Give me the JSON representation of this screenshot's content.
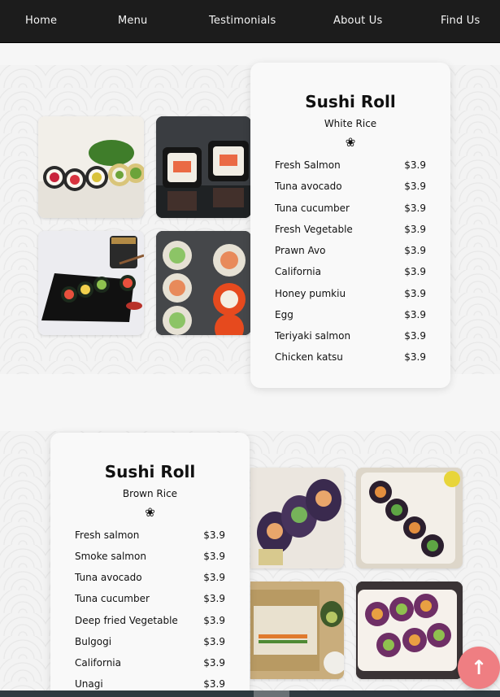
{
  "nav": {
    "items": [
      {
        "label": "Home"
      },
      {
        "label": "Menu"
      },
      {
        "label": "Testimonials"
      },
      {
        "label": "About Us"
      },
      {
        "label": "Find Us"
      }
    ]
  },
  "menu_white": {
    "title": "Sushi Roll",
    "subtitle": "White Rice",
    "ornament": "❀",
    "items": [
      {
        "name": "Fresh Salmon",
        "price": "$3.9"
      },
      {
        "name": "Tuna avocado",
        "price": "$3.9"
      },
      {
        "name": "Tuna cucumber",
        "price": "$3.9"
      },
      {
        "name": "Fresh Vegetable",
        "price": "$3.9"
      },
      {
        "name": "Prawn Avo",
        "price": "$3.9"
      },
      {
        "name": "California",
        "price": "$3.9"
      },
      {
        "name": "Honey pumkiu",
        "price": "$3.9"
      },
      {
        "name": "Egg",
        "price": "$3.9"
      },
      {
        "name": "Teriyaki salmon",
        "price": "$3.9"
      },
      {
        "name": "Chicken katsu",
        "price": "$3.9"
      }
    ]
  },
  "menu_brown": {
    "title": "Sushi Roll",
    "subtitle": "Brown Rice",
    "ornament": "❀",
    "items": [
      {
        "name": "Fresh salmon",
        "price": "$3.9"
      },
      {
        "name": "Smoke salmon",
        "price": "$3.9"
      },
      {
        "name": "Tuna avocado",
        "price": "$3.9"
      },
      {
        "name": "Tuna cucumber",
        "price": "$3.9"
      },
      {
        "name": "Deep fried Vegetable",
        "price": "$3.9"
      },
      {
        "name": "Bulgogi",
        "price": "$3.9"
      },
      {
        "name": "California",
        "price": "$3.9"
      },
      {
        "name": "Unagi",
        "price": "$3.9"
      }
    ]
  },
  "colors": {
    "nav_bg": "#1c1c1c",
    "scroll_button": "#ef7e82"
  },
  "icons": {
    "scroll_top": "↑"
  }
}
